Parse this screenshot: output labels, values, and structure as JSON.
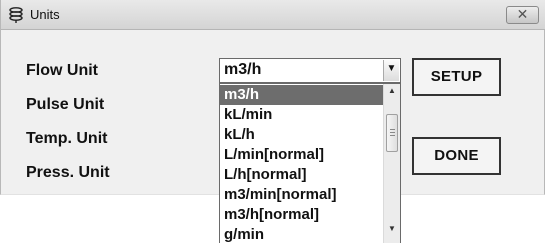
{
  "window": {
    "title": "Units",
    "icon": "units-app-icon",
    "close_icon": "close-icon"
  },
  "labels": {
    "flow": "Flow Unit",
    "pulse": "Pulse Unit",
    "temp": "Temp. Unit",
    "press": "Press. Unit"
  },
  "flow_combo": {
    "value": "m3/h",
    "options": [
      "m3/h",
      "kL/min",
      "kL/h",
      "L/min[normal]",
      "L/h[normal]",
      "m3/min[normal]",
      "m3/h[normal]",
      "g/min"
    ],
    "selected_index": 0
  },
  "buttons": {
    "setup": "SETUP",
    "done": "DONE"
  },
  "colors": {
    "selection": "#6d6d6d",
    "dialog_bg": "#f0f0f0"
  }
}
